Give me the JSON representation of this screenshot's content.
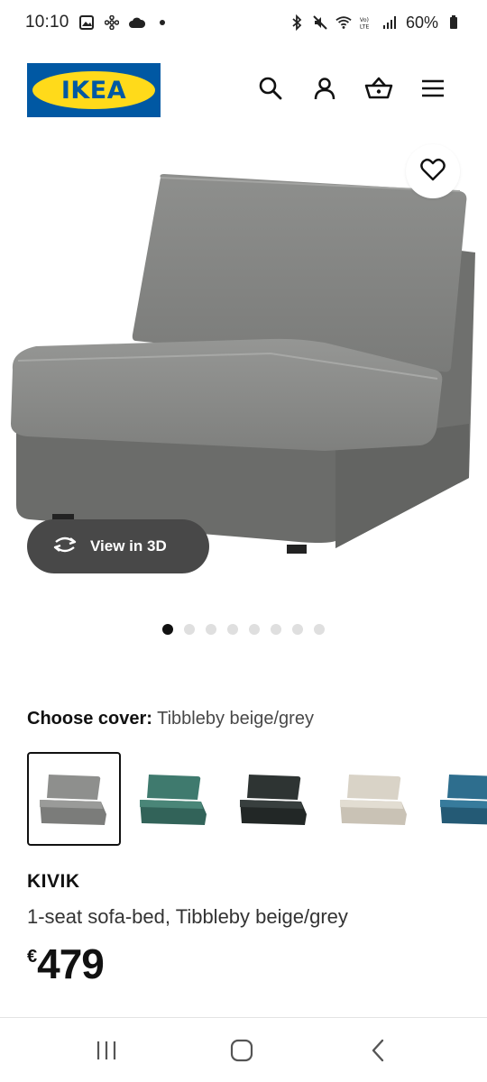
{
  "status_bar": {
    "time": "10:10",
    "battery": "60%",
    "left_icons": [
      "image-icon",
      "pinwheel-icon",
      "cloud-icon",
      "dot-icon"
    ],
    "right_icons": [
      "bluetooth-icon",
      "mute-icon",
      "wifi-icon",
      "volte-icon",
      "signal-icon",
      "battery-icon"
    ]
  },
  "header": {
    "logo_text": "IKEA",
    "icons": [
      "search-icon",
      "account-icon",
      "basket-icon",
      "menu-icon"
    ]
  },
  "product_image": {
    "view_3d_label": "View in 3D",
    "carousel_total": 8,
    "carousel_active": 0
  },
  "cover": {
    "label": "Choose cover:",
    "value": "Tibbleby beige/grey",
    "swatches": [
      {
        "name": "Tibbleby beige/grey",
        "color": "#8e8f8d",
        "selected": true
      },
      {
        "name": "green",
        "color": "#3f7a6e",
        "selected": false
      },
      {
        "name": "dark",
        "color": "#2e3433",
        "selected": false
      },
      {
        "name": "beige",
        "color": "#d9d3c7",
        "selected": false
      },
      {
        "name": "blue",
        "color": "#2e6e8e",
        "selected": false
      }
    ]
  },
  "product": {
    "name": "KIVIK",
    "description": "1-seat sofa-bed, Tibbleby beige/grey",
    "currency": "€",
    "price": "479"
  },
  "navbar": {
    "icons": [
      "recent-apps-icon",
      "home-icon",
      "back-icon"
    ]
  },
  "colors": {
    "ikea_blue": "#0058a3",
    "ikea_yellow": "#ffda1a",
    "pill_bg": "#484848"
  }
}
